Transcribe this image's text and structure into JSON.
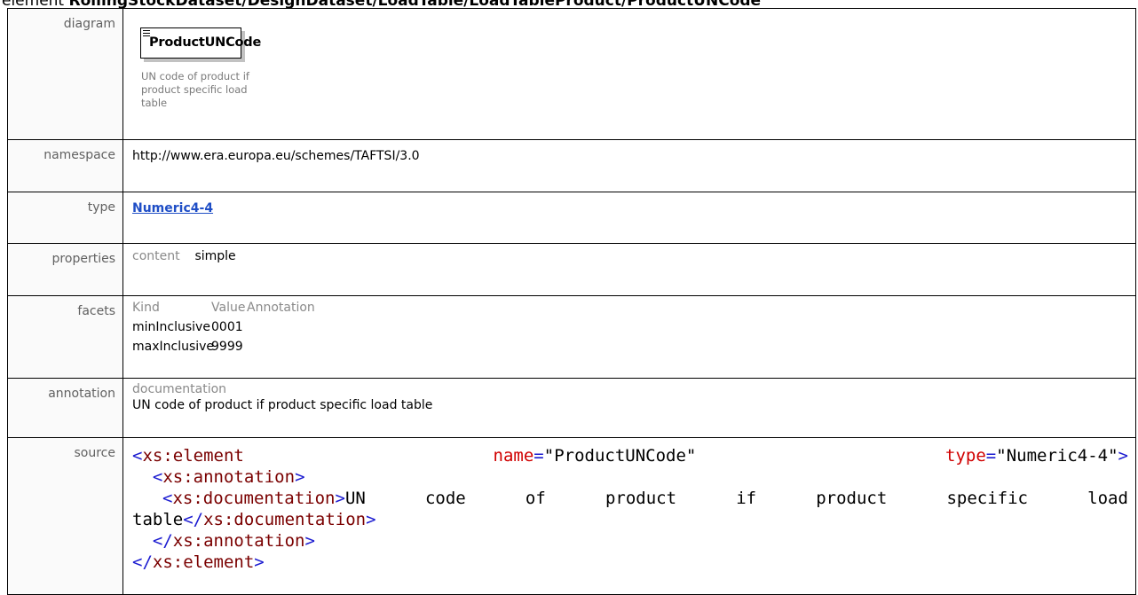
{
  "heading": {
    "kind": "element",
    "path": "RollingStockDataset/DesignDataset/LoadTable/LoadTableProduct/ProductUNCode"
  },
  "rows": {
    "diagram": {
      "label": "diagram",
      "element_name": "ProductUNCode",
      "description": "UN code of product if product specific load table"
    },
    "namespace": {
      "label": "namespace",
      "value": "http://www.era.europa.eu/schemes/TAFTSI/3.0"
    },
    "type": {
      "label": "type",
      "value": "Numeric4-4"
    },
    "properties": {
      "label": "properties",
      "key": "content",
      "value": "simple"
    },
    "facets": {
      "label": "facets",
      "headers": [
        "Kind",
        "Value",
        "Annotation"
      ],
      "rows": [
        {
          "kind": "minInclusive",
          "value": "0001"
        },
        {
          "kind": "maxInclusive",
          "value": "9999"
        }
      ]
    },
    "annotation": {
      "label": "annotation",
      "sub_label": "documentation",
      "text": "UN code of product if product specific load table"
    },
    "source": {
      "label": "source",
      "open_tag": "xs:element",
      "attr_name": "name",
      "attr_name_value": "\"ProductUNCode\"",
      "attr_type": "type",
      "attr_type_value": "\"Numeric4-4\"",
      "annotation_tag": "xs:annotation",
      "documentation_tag": "xs:documentation",
      "documentation_words": [
        "UN",
        "code",
        "of",
        "product",
        "if",
        "product",
        "specific",
        "load"
      ],
      "documentation_tail": "table"
    }
  }
}
